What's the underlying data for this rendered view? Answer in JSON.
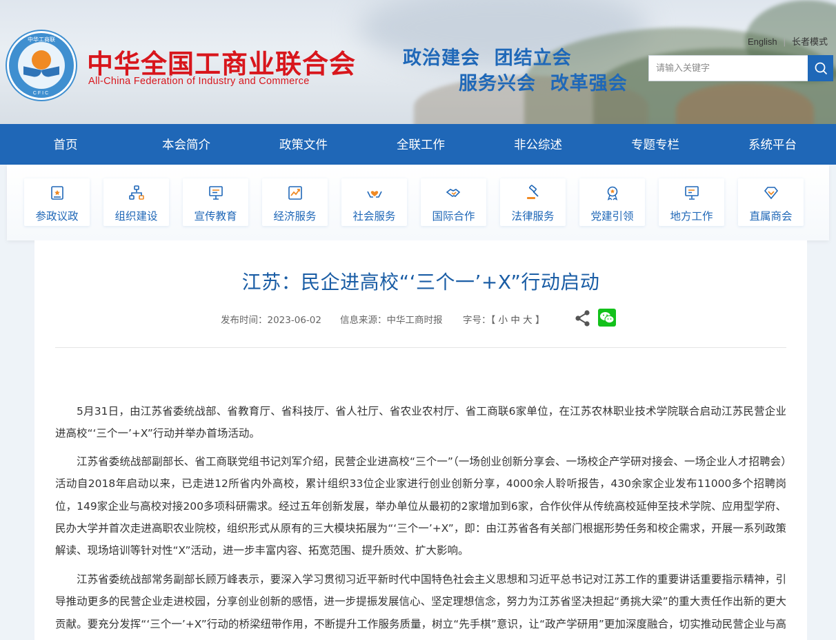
{
  "header": {
    "logo": {
      "ring_top": "中华工商联",
      "ring_bottom": "CFIC"
    },
    "org_name_cn": "中华全国工商业联合会",
    "org_name_en": "All-China Federation of Industry and Commerce",
    "slogan_line1": "政治建会  团结立会",
    "slogan_line2": "服务兴会  改革强会",
    "links": {
      "english": "English",
      "elder_mode": "长者模式"
    },
    "search": {
      "placeholder": "请输入关键字",
      "icon": "search-icon"
    },
    "colors": {
      "brand_red": "#d8161c",
      "brand_blue": "#1f67b7"
    }
  },
  "nav": {
    "items": [
      "首页",
      "本会简介",
      "政策文件",
      "全联工作",
      "非公综述",
      "专题专栏",
      "系统平台"
    ]
  },
  "quick_links": [
    {
      "label": "参政议政",
      "icon": "document-star-icon"
    },
    {
      "label": "组织建设",
      "icon": "org-chart-icon"
    },
    {
      "label": "宣传教育",
      "icon": "presentation-board-icon"
    },
    {
      "label": "经济服务",
      "icon": "chart-trend-icon"
    },
    {
      "label": "社会服务",
      "icon": "hands-heart-icon"
    },
    {
      "label": "国际合作",
      "icon": "handshake-icon"
    },
    {
      "label": "法律服务",
      "icon": "gavel-icon"
    },
    {
      "label": "党建引领",
      "icon": "award-badge-icon"
    },
    {
      "label": "地方工作",
      "icon": "monitor-icon"
    },
    {
      "label": "直属商会",
      "icon": "diamond-icon"
    }
  ],
  "article": {
    "title": "江苏：民企进高校“‘三个一’+X”行动启动",
    "meta": {
      "date_label": "发布时间：",
      "date": "2023-06-02",
      "source_label": "信息来源：",
      "source": "中华工商时报",
      "font_size_label": "字号：",
      "font_bracket_open": "【",
      "font_small": "小",
      "font_medium": "中",
      "font_large": "大",
      "font_bracket_close": "】"
    },
    "paragraphs": [
      "5月31日，由江苏省委统战部、省教育厅、省科技厅、省人社厅、省农业农村厅、省工商联6家单位，在江苏农林职业技术学院联合启动江苏民营企业进高校“‘三个一’+X”行动并举办首场活动。",
      "江苏省委统战部副部长、省工商联党组书记刘军介绍，民营企业进高校“三个一”（一场创业创新分享会、一场校企产学研对接会、一场企业人才招聘会）活动自2018年启动以来，已走进12所省内外高校，累计组织33位企业家进行创业创新分享，4000余人聆听报告，430余家企业发布11000多个招聘岗位，149家企业与高校对接200多项科研需求。经过五年创新发展，举办单位从最初的2家增加到6家，合作伙伴从传统高校延伸至技术学院、应用型学府、民办大学并首次走进高职农业院校，组织形式从原有的三大模块拓展为“‘三个一’+X”，即：由江苏省各有关部门根据形势任务和校企需求，开展一系列政策解读、现场培训等针对性“X”活动，进一步丰富内容、拓宽范围、提升质效、扩大影响。",
      "江苏省委统战部常务副部长顾万峰表示，要深入学习贯彻习近平新时代中国特色社会主义思想和习近平总书记对江苏工作的重要讲话重要指示精神，引导推动更多的民营企业走进校园，分享创业创新的感悟，进一步提振发展信心、坚定理想信念，努力为江苏省坚决担起“勇挑大梁”的重大责任作出新的更大贡献。要充分发挥“‘三个一’+X”行动的桥梁纽带作用，不断提升工作服务质量，树立“先手棋”意识，让“政产学研用”更加深度融合，切实推动民营企业与高校双向奔赴、互利共赢。"
    ]
  }
}
